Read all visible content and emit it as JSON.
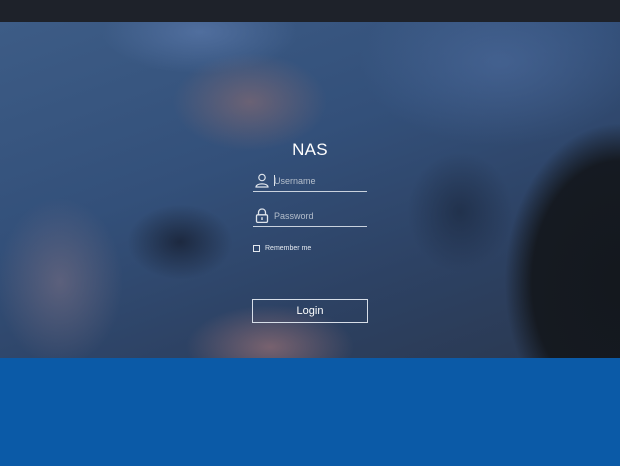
{
  "login": {
    "title": "NAS",
    "username": {
      "placeholder": "Username",
      "value": "",
      "icon": "user-icon"
    },
    "password": {
      "placeholder": "Password",
      "value": "",
      "icon": "lock-icon"
    },
    "remember_label": "Remember me",
    "remember_checked": false,
    "login_button": "Login"
  },
  "colors": {
    "top_bar": "#1e222a",
    "bottom_band": "#0b5aa7",
    "text": "#ffffff"
  }
}
